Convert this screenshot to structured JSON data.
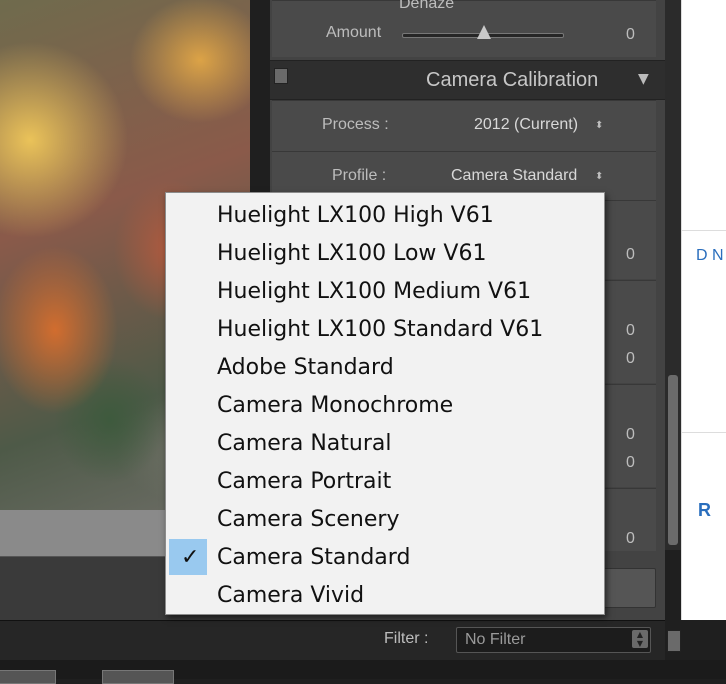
{
  "top_panel": {
    "dehaze_label": "Dehaze",
    "amount_label": "Amount",
    "amount_value": "0",
    "amount_slider_level": 0.5
  },
  "calibration": {
    "title": "Camera Calibration",
    "process_label": "Process :",
    "process_value": "2012 (Current)",
    "profile_label": "Profile :",
    "profile_value": "Camera Standard",
    "hidden_values": [
      "0",
      "0",
      "0",
      "0",
      "0",
      "0"
    ]
  },
  "menu": {
    "items": [
      {
        "label": "Huelight LX100 High V61",
        "checked": false
      },
      {
        "label": "Huelight LX100 Low V61",
        "checked": false
      },
      {
        "label": "Huelight LX100 Medium V61",
        "checked": false
      },
      {
        "label": "Huelight LX100 Standard V61",
        "checked": false
      },
      {
        "label": "Adobe Standard",
        "checked": false
      },
      {
        "label": "Camera Monochrome",
        "checked": false
      },
      {
        "label": "Camera Natural",
        "checked": false
      },
      {
        "label": "Camera Portrait",
        "checked": false
      },
      {
        "label": "Camera Scenery",
        "checked": false
      },
      {
        "label": "Camera Standard",
        "checked": true
      },
      {
        "label": "Camera Vivid",
        "checked": false
      }
    ],
    "check_glyph": "✓"
  },
  "filter": {
    "label": "Filter :",
    "value": "No Filter"
  },
  "other_window": {
    "partial_text_1": "D N",
    "partial_text_2": "R"
  },
  "colors": {
    "panel_bg": "#434343",
    "menu_bg": "#f2f2f2",
    "menu_highlight": "#99c9ef",
    "link_blue": "#2a6ebd"
  }
}
